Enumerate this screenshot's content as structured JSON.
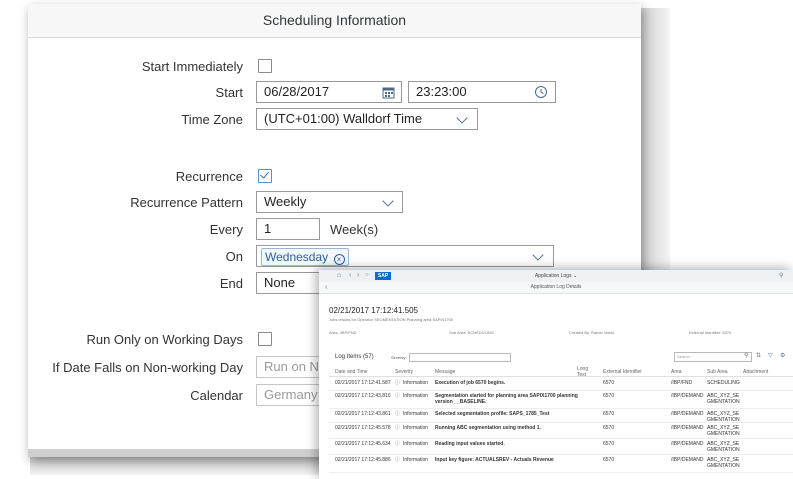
{
  "dialog": {
    "title": "Scheduling Information",
    "start_immediately": {
      "label": "Start Immediately",
      "checked": false
    },
    "start": {
      "label": "Start",
      "date": "06/28/2017",
      "time": "23:23:00"
    },
    "time_zone": {
      "label": "Time Zone",
      "value": "(UTC+01:00) Walldorf Time"
    },
    "recurrence": {
      "label": "Recurrence",
      "checked": true
    },
    "recurrence_pattern": {
      "label": "Recurrence Pattern",
      "value": "Weekly"
    },
    "every": {
      "label": "Every",
      "value": "1",
      "unit": "Week(s)"
    },
    "on": {
      "label": "On",
      "token": "Wednesday"
    },
    "end": {
      "label": "End",
      "value": "None"
    },
    "run_working_days": {
      "label": "Run Only on Working Days",
      "checked": false
    },
    "non_working_day": {
      "label": "If Date Falls on Non-working Day",
      "value": "Run on Ne"
    },
    "calendar": {
      "label": "Calendar",
      "value": "Germany ("
    }
  },
  "app_log": {
    "shell_title": "Application Logs",
    "sub_title": "Application Log Details",
    "logo": "SAP",
    "timestamp": "02/21/2017 17:12:41.505",
    "subtitle": "Jobs results for Operator SEGMENTATION Planning area SAPIX1700",
    "meta": {
      "area": "Area: /IBP/FND",
      "sub_area": "Sub Area: SCHEDULING",
      "created_by": "Created By: Rainer Mertz",
      "external_id": "External Identifier: 6570"
    },
    "log_items_label": "Log Items (57)",
    "severity_label": "Severity:",
    "search_placeholder": "Search",
    "columns": [
      "Date and Time",
      "Severity",
      "Message",
      "Long Text",
      "External Identifier",
      "Area",
      "Sub Area",
      "Attachment"
    ],
    "rows": [
      {
        "date": "02/21/2017 17:12:41.587",
        "severity": "Information",
        "message": "Execution of job 6570 begins.",
        "ext": "6570",
        "area": "/IBP/FND",
        "sub": "SCHEDULING"
      },
      {
        "date": "02/21/2017 17:12:43.816",
        "severity": "Information",
        "message": "Segmentation started for planning area SAPIX1700 planning version __BASELINE.",
        "ext": "6570",
        "area": "/IBP/DEMAND",
        "sub": "ABC_XYZ_SEGMENTATION"
      },
      {
        "date": "02/21/2017 17:12:43.861",
        "severity": "Information",
        "message": "Selected segmentation profile: SAPS_1785_Test",
        "ext": "6570",
        "area": "/IBP/DEMAND",
        "sub": "ABC_XYZ_SEGMENTATION"
      },
      {
        "date": "02/21/2017 17:12:45.578",
        "severity": "Information",
        "message": "Running ABC segmentation using method 1.",
        "ext": "6570",
        "area": "/IBP/DEMAND",
        "sub": "ABC_XYZ_SEGMENTATION"
      },
      {
        "date": "02/21/2017 17:12:45.634",
        "severity": "Information",
        "message": "Reading input values started.",
        "ext": "6570",
        "area": "/IBP/DEMAND",
        "sub": "ABC_XYZ_SEGMENTATION"
      },
      {
        "date": "02/21/2017 17:12:45.886",
        "severity": "Information",
        "message": "Input key figure: ACTUALSREV - Actuals Revenue",
        "ext": "6570",
        "area": "/IBP/DEMAND",
        "sub": "ABC_XYZ_SEGMENTATION"
      }
    ]
  }
}
